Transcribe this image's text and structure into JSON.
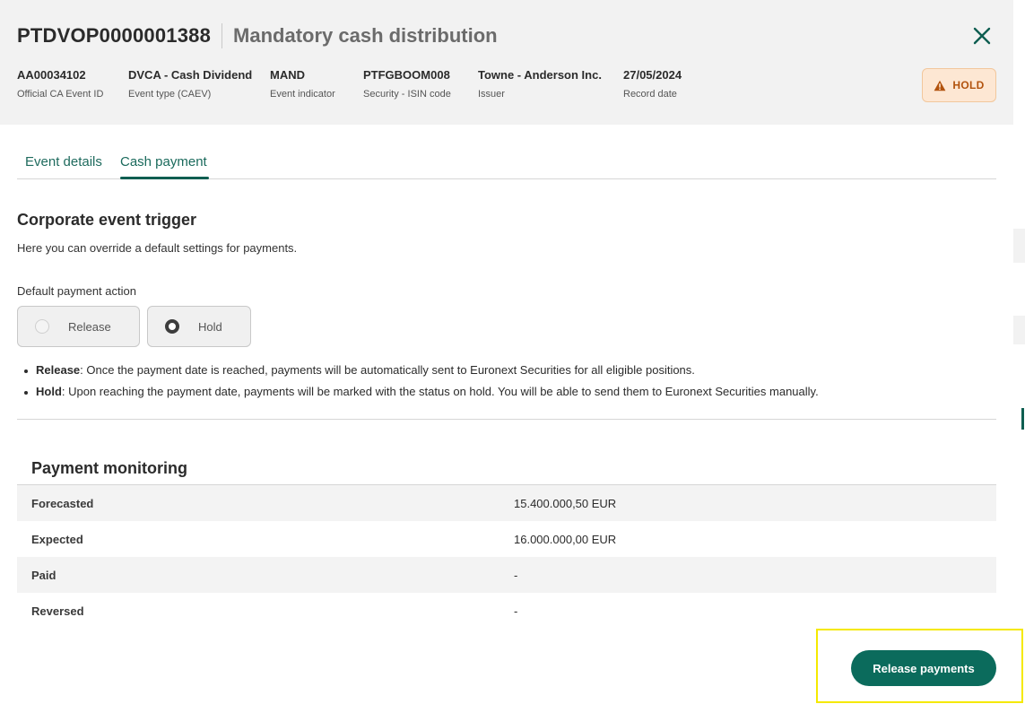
{
  "header": {
    "reference": "PTDVOP0000001388",
    "title": "Mandatory cash distribution",
    "meta": [
      {
        "value": "AA00034102",
        "label": "Official CA Event ID"
      },
      {
        "value": "DVCA - Cash Dividend",
        "label": "Event type (CAEV)"
      },
      {
        "value": "MAND",
        "label": "Event indicator"
      },
      {
        "value": "PTFGBOOM008",
        "label": "Security - ISIN code"
      },
      {
        "value": "Towne - Anderson Inc.",
        "label": "Issuer"
      },
      {
        "value": "27/05/2024",
        "label": "Record date"
      }
    ],
    "status": "HOLD",
    "close_icon": "close-icon",
    "status_icon": "warning-icon"
  },
  "tabs": [
    {
      "label": "Event details",
      "active": false
    },
    {
      "label": "Cash payment",
      "active": true
    }
  ],
  "trigger": {
    "title": "Corporate event trigger",
    "description": "Here you can override a default settings for payments.",
    "field_label": "Default payment action",
    "options": [
      {
        "label": "Release",
        "selected": false
      },
      {
        "label": "Hold",
        "selected": true
      }
    ],
    "notes": [
      {
        "term": "Release",
        "text": ": Once the payment date is reached, payments will be automatically sent to Euronext Securities for all eligible positions."
      },
      {
        "term": "Hold",
        "text": ": Upon reaching the payment date, payments will be marked with the status on hold. You will be able to send them to Euronext Securities manually."
      }
    ]
  },
  "monitoring": {
    "title": "Payment monitoring",
    "rows": [
      {
        "label": "Forecasted",
        "value": "15.400.000,50 EUR"
      },
      {
        "label": "Expected",
        "value": "16.000.000,00 EUR"
      },
      {
        "label": "Paid",
        "value": "-"
      },
      {
        "label": "Reversed",
        "value": "-"
      }
    ]
  },
  "actions": {
    "release_label": "Release payments"
  },
  "colors": {
    "accent": "#0b6b5c",
    "hold_bg": "#fde7d3",
    "hold_text": "#b2530e",
    "highlight": "#f5e900"
  }
}
